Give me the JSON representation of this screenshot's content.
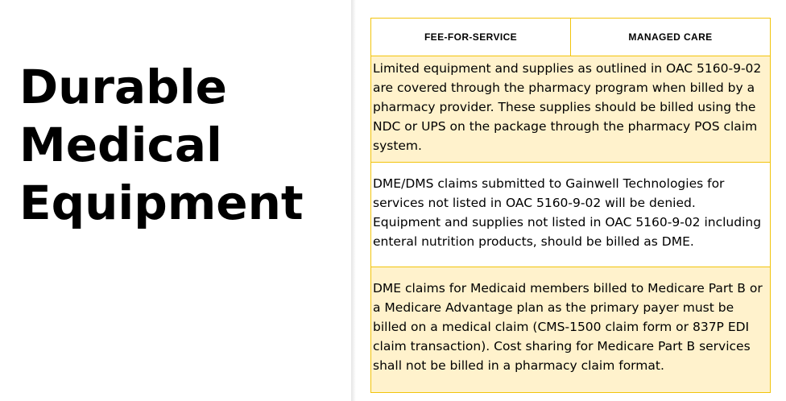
{
  "slide": {
    "title": "Durable\nMedical\nEquipment"
  },
  "table": {
    "headers": [
      "FEE-FOR-SERVICE",
      "MANAGED CARE"
    ],
    "rows": [
      "Limited equipment and supplies as outlined in OAC 5160-9-02 are covered through the pharmacy program when billed by a pharmacy provider.  These supplies should be billed using the NDC or UPS on the package through the pharmacy POS claim system.",
      "DME/DMS claims submitted to Gainwell Technologies for services not listed in OAC 5160-9-02 will be denied. Equipment and supplies not listed in OAC 5160-9-02 including enteral nutrition products, should be billed as DME.",
      "DME claims for Medicaid members billed to Medicare Part B or a Medicare Advantage plan as the primary payer must be billed on a medical claim (CMS-1500 claim form or 837P EDI claim transaction). Cost sharing for Medicare Part B services shall not be billed in a pharmacy claim format."
    ]
  },
  "colors": {
    "border": "#f2c40c",
    "shaded_row": "#fff2cc",
    "text": "#000000"
  }
}
